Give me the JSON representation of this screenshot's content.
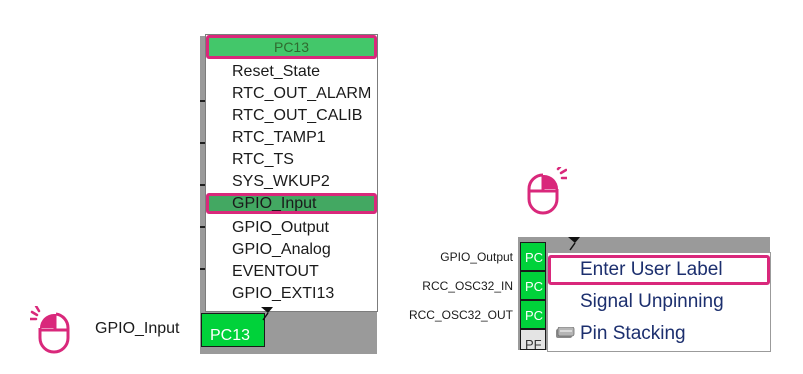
{
  "left_panel": {
    "dropdown_header": "PC13",
    "items": [
      "Reset_State",
      "RTC_OUT_ALARM",
      "RTC_OUT_CALIB",
      "RTC_TAMP1",
      "RTC_TS",
      "SYS_WKUP2",
      "GPIO_Input",
      "GPIO_Output",
      "GPIO_Analog",
      "EVENTOUT",
      "GPIO_EXTI13"
    ],
    "selected_item": "GPIO_Input",
    "pin_name": "PC13",
    "pin_signal_label": "GPIO_Input"
  },
  "right_panel": {
    "pin_labels": [
      "GPIO_Output",
      "RCC_OSC32_IN",
      "RCC_OSC32_OUT"
    ],
    "pin_prefixes": [
      "PC",
      "PC",
      "PC",
      "PF"
    ],
    "context_menu": {
      "items": [
        "Enter User Label",
        "Signal Unpinning",
        "Pin Stacking"
      ],
      "selected_item": "Enter User Label"
    }
  },
  "colors": {
    "accent_highlight": "#d9287b",
    "pin_assigned": "#00d23a",
    "dropdown_selection": "#43a862",
    "chip_body": "#9a9a9a"
  },
  "icons": [
    "mouse-left-click-icon",
    "mouse-right-click-icon",
    "pin-marker-icon",
    "pin-stacking-icon"
  ]
}
